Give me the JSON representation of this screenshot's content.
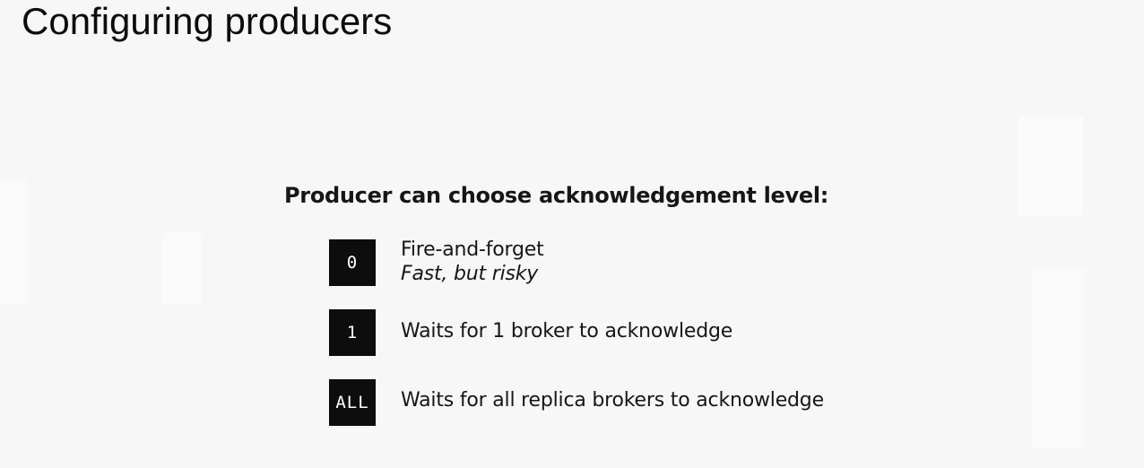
{
  "slide": {
    "title": "Configuring producers",
    "subheading": "Producer can choose acknowledgement level:"
  },
  "levels": [
    {
      "badge": "0",
      "label": "Fire-and-forget",
      "note": "Fast, but risky"
    },
    {
      "badge": "1",
      "label": "Waits for 1 broker to acknowledge"
    },
    {
      "badge": "ALL",
      "label": "Waits for all replica brokers to acknowledge"
    }
  ],
  "colors": {
    "background": "#f7f7f7",
    "badge_background": "#0d0d0d",
    "badge_text": "#ffffff",
    "text": "#161616"
  }
}
